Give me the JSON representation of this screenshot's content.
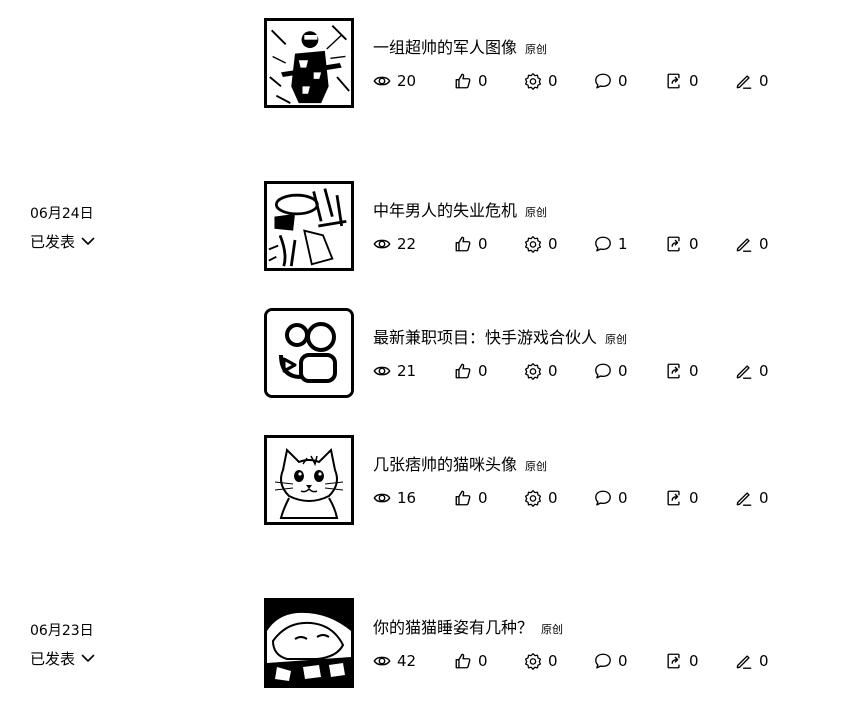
{
  "groups": [
    {
      "date": "",
      "status": ""
    },
    {
      "date": "06月24日",
      "status": "已发表"
    },
    {
      "date": "06月23日",
      "status": "已发表"
    }
  ],
  "status_icon": "chevron-down-icon",
  "stat_icons": [
    "eye-icon",
    "thumbs-up-icon",
    "gear-icon",
    "comment-icon",
    "share-icon",
    "pen-icon"
  ],
  "articles": [
    {
      "title": "一组超帅的军人图像",
      "badge": "原创",
      "thumbnail": "soldier-image",
      "stats": {
        "views": "20",
        "likes": "0",
        "settings": "0",
        "comments": "0",
        "shares": "0",
        "edits": "0"
      }
    },
    {
      "title": "中年男人的失业危机",
      "badge": "原创",
      "thumbnail": "man-sketch-image",
      "stats": {
        "views": "22",
        "likes": "0",
        "settings": "0",
        "comments": "1",
        "shares": "0",
        "edits": "0"
      }
    },
    {
      "title": "最新兼职项目：快手游戏合伙人",
      "badge": "原创",
      "thumbnail": "kuaishou-logo",
      "stats": {
        "views": "21",
        "likes": "0",
        "settings": "0",
        "comments": "0",
        "shares": "0",
        "edits": "0"
      }
    },
    {
      "title": "几张痞帅的猫咪头像",
      "badge": "原创",
      "thumbnail": "cat-image",
      "stats": {
        "views": "16",
        "likes": "0",
        "settings": "0",
        "comments": "0",
        "shares": "0",
        "edits": "0"
      }
    },
    {
      "title": "你的猫猫睡姿有几种？",
      "badge": "原创",
      "thumbnail": "sleeping-cat-image",
      "stats": {
        "views": "42",
        "likes": "0",
        "settings": "0",
        "comments": "0",
        "shares": "0",
        "edits": "0"
      }
    }
  ]
}
